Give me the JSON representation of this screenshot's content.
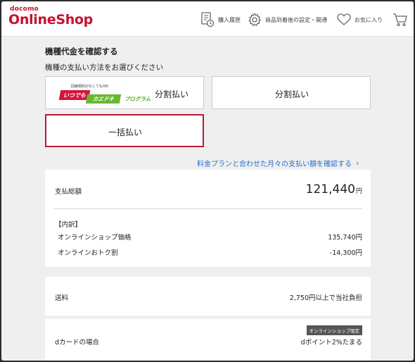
{
  "header": {
    "logo_small": "docomo",
    "logo_big": "OnlineShop",
    "nav": [
      {
        "icon": "receipt-clock-icon",
        "label": "購入履歴"
      },
      {
        "icon": "gear-icon",
        "label": "商品到着後の設定・開通"
      },
      {
        "icon": "heart-icon",
        "label": "お気に入り"
      },
      {
        "icon": "cart-icon",
        "label": ""
      }
    ]
  },
  "main": {
    "title": "機種代金を確認する",
    "subtitle": "機種の支払い方法をお選びください",
    "options": {
      "promo": {
        "top_text": "回線契約がなくてもOK!",
        "badge1": "いつでも",
        "badge2": "カエドキ",
        "program": "プログラム",
        "label": "分割払い"
      },
      "installment_label": "分割払い",
      "lump_sum_label": "一括払い"
    },
    "monthly_link": "料金プランと合わせた月々の支払い額を確認する",
    "summary": {
      "total_label": "支払総額",
      "total_value": "121,440",
      "total_unit": "円",
      "breakdown_title": "【内訳】",
      "items": [
        {
          "label": "オンラインショップ価格",
          "value": "135,740円"
        },
        {
          "label": "オンラインおトク割",
          "value": "-14,300円"
        }
      ]
    },
    "shipping": {
      "label": "送料",
      "value": "2,750円以上で当社負担"
    },
    "dcard": {
      "tag": "オンラインショップ限定",
      "label": "dカードの場合",
      "value": "dポイント2%たまる"
    }
  },
  "colors": {
    "brand_red": "#c8102e",
    "selected_border": "#b81b3a",
    "link_blue": "#2a6fc9",
    "green": "#6ab832"
  }
}
